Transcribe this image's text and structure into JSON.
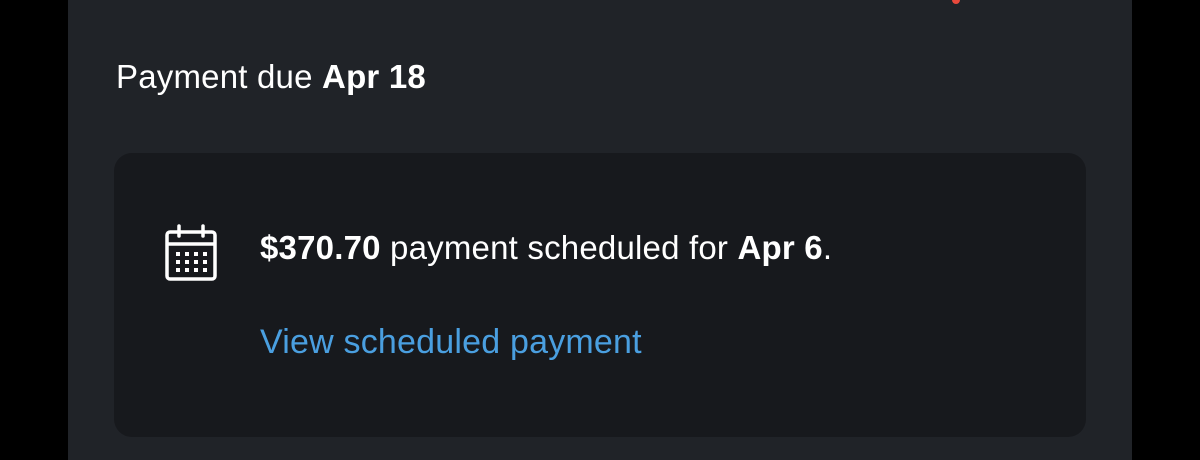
{
  "payment_due": {
    "label": "Payment due",
    "date": "Apr 18"
  },
  "scheduled_card": {
    "icon": "calendar-icon",
    "amount": "$370.70",
    "text_middle": " payment scheduled for ",
    "date": "Apr 6",
    "text_end": ".",
    "link_label": "View scheduled payment"
  },
  "colors": {
    "background": "#202328",
    "card": "#17191d",
    "text": "#ffffff",
    "link": "#4a9fe0"
  }
}
